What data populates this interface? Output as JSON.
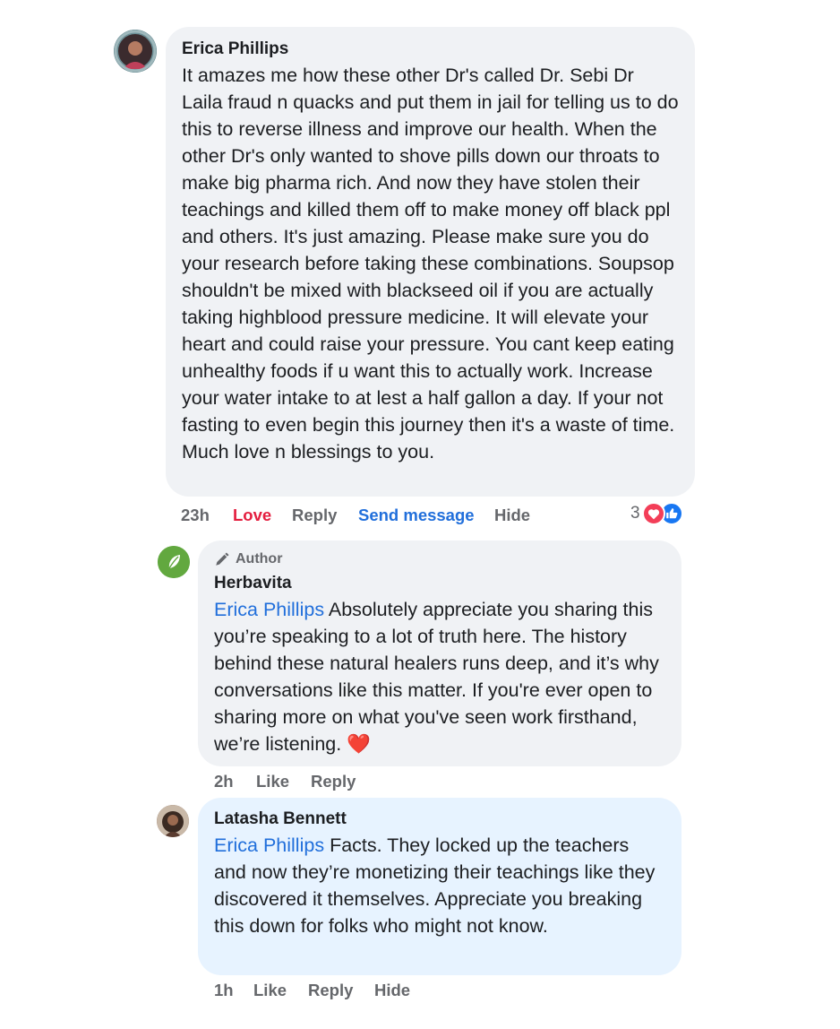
{
  "comments": [
    {
      "author": "Erica Phillips",
      "text": "It amazes me how these other Dr's called Dr. Sebi Dr Laila fraud n quacks and put them in jail for telling us to do this to reverse illness and improve our health. When the other Dr's only wanted to shove pills down our throats to make big pharma rich. And now they have stolen their teachings and killed them off to make money off black ppl and others. It's just amazing. Please make sure you do your research before taking these combinations. Soupsop shouldn't be mixed with blackseed oil if you are actually taking highblood pressure medicine. It will elevate your heart and could raise your pressure. You cant keep eating unhealthy foods if u want this to actually work. Increase your water intake to at lest a half gallon a day. If your not fasting to even begin this journey then it's a waste of time. Much love n blessings to you.",
      "time": "23h",
      "actions": {
        "love": "Love",
        "reply": "Reply",
        "send_message": "Send message",
        "hide": "Hide"
      },
      "reaction_count": "3",
      "reaction_icons": [
        "love-reaction-icon",
        "like-reaction-icon"
      ]
    },
    {
      "badge": "Author",
      "author": "Herbavita",
      "mention": "Erica Phillips",
      "text": "Absolutely appreciate you sharing this you’re speaking to a lot of truth here. The history behind these natural healers runs deep, and it’s why conversations like this matter. If you're ever open to sharing more on what you've seen work firsthand, we’re listening.",
      "emoji": "❤️",
      "time": "2h",
      "actions": {
        "like": "Like",
        "reply": "Reply"
      }
    },
    {
      "author": "Latasha Bennett",
      "mention": "Erica Phillips",
      "text": "Facts. They locked up the teachers and now they’re monetizing their teachings like they discovered it themselves. Appreciate you breaking this down for folks who might not know.",
      "time": "1h",
      "actions": {
        "like": "Like",
        "reply": "Reply",
        "hide": "Hide"
      }
    }
  ],
  "colors": {
    "bubble": "#f0f2f5",
    "highlight_bubble": "#e7f3ff",
    "link": "#216fdb",
    "love": "#e41e3f",
    "muted": "#65676b"
  }
}
